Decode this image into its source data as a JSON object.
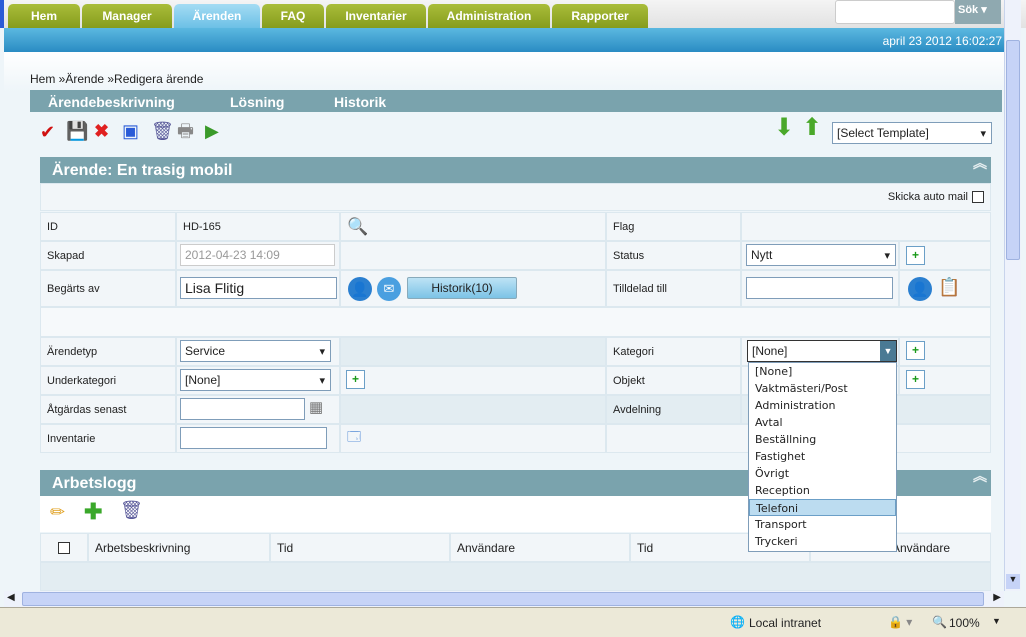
{
  "nav": {
    "tabs": [
      "Hem",
      "Manager",
      "Ärenden",
      "FAQ",
      "Inventarier",
      "Administration",
      "Rapporter"
    ],
    "active": "Ärenden",
    "search_button": "Sök",
    "search_value": ""
  },
  "datetime": "april 23 2012 16:02:27",
  "breadcrumb": [
    "Hem »",
    "Ärende »",
    "Redigera ärende"
  ],
  "subtabs": [
    "Ärendebeskrivning",
    "Lösning",
    "Historik"
  ],
  "toolbar": {
    "icons": [
      "save-close-icon",
      "save-icon",
      "delete-x-icon",
      "save-cancel-icon",
      "trash-icon",
      "print-icon",
      "forward-icon"
    ],
    "template_select": "[Select Template]"
  },
  "ticket": {
    "title": "Ärende: En trasig mobil",
    "auto_mail_label": "Skicka auto mail",
    "auto_mail_checked": false,
    "id_label": "ID",
    "id_value": "HD-165",
    "flag_label": "Flag",
    "created_label": "Skapad",
    "created_value": "2012-04-23 14:09",
    "status_label": "Status",
    "status_value": "Nytt",
    "requested_label": "Begärts av",
    "requested_value": "Lisa Flitig",
    "history_button": "Historik(10)",
    "assigned_label": "Tilldelad till",
    "assigned_value": "",
    "type_label": "Ärendetyp",
    "type_value": "Service",
    "category_label": "Kategori",
    "category_value": "[None]",
    "subcat_label": "Underkategori",
    "subcat_value": "[None]",
    "object_label": "Objekt",
    "due_label": "Åtgärdas senast",
    "due_value": "",
    "dept_label": "Avdelning",
    "inventory_label": "Inventarie",
    "inventory_value": ""
  },
  "category_options": [
    "[None]",
    "Vaktmästeri/Post",
    "Administration",
    "Avtal",
    "Beställning",
    "Fastighet",
    "Övrigt",
    "Reception",
    "Telefoni",
    "Transport",
    "Tryckeri"
  ],
  "category_highlighted": "Telefoni",
  "worklog": {
    "title": "Arbetslogg",
    "columns": [
      "Arbetsbeskrivning",
      "Tid",
      "Användare",
      "Tid",
      "Användare"
    ]
  },
  "statusbar": {
    "zone": "Local intranet",
    "zoom": "100%"
  }
}
